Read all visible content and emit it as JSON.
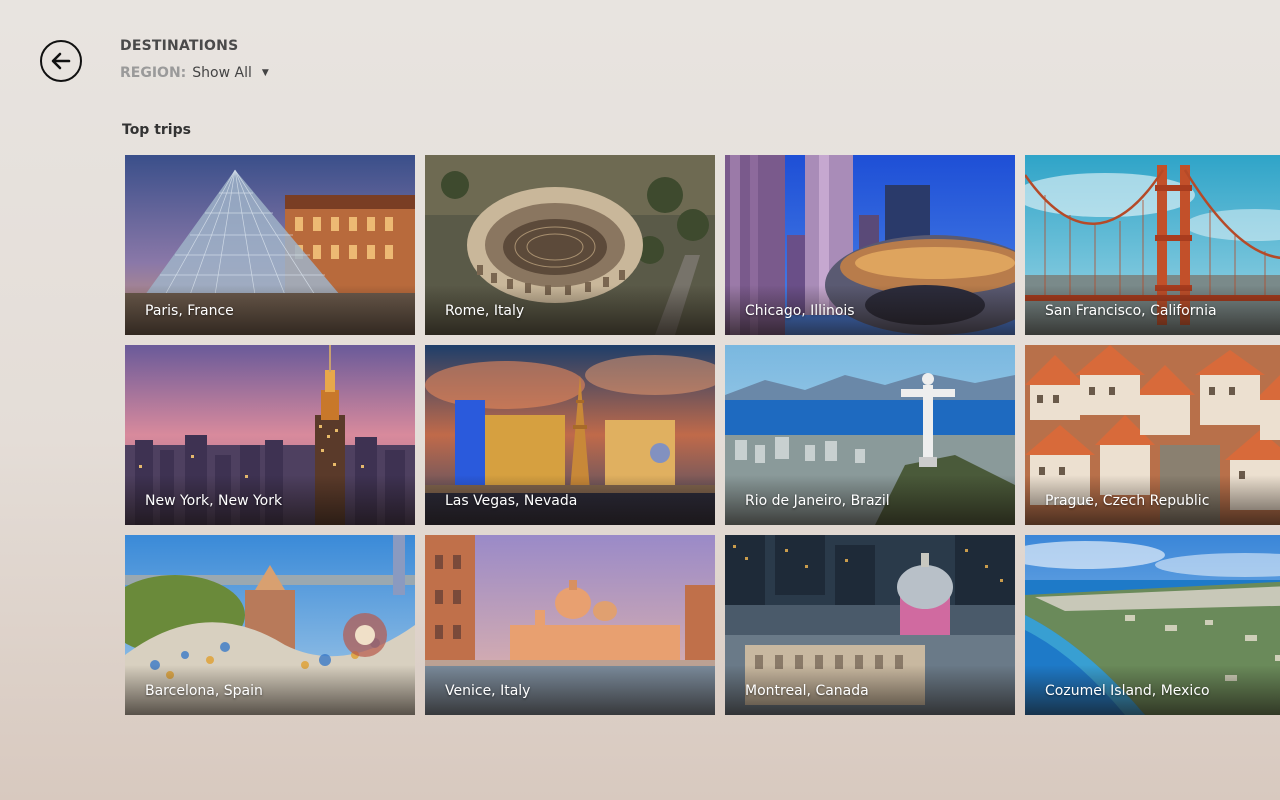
{
  "header": {
    "title": "DESTINATIONS",
    "region_label": "REGION:",
    "region_value": "Show All"
  },
  "section": {
    "title": "Top trips"
  },
  "destinations": [
    {
      "label": "Paris, France",
      "scene": "pyramid"
    },
    {
      "label": "Rome, Italy",
      "scene": "colosseum"
    },
    {
      "label": "Chicago, Illinois",
      "scene": "skyline"
    },
    {
      "label": "San Francisco, California",
      "scene": "bridge"
    },
    {
      "label": "New York, New York",
      "scene": "dusk-city"
    },
    {
      "label": "Las Vegas, Nevada",
      "scene": "vegas"
    },
    {
      "label": "Rio de Janeiro, Brazil",
      "scene": "rio"
    },
    {
      "label": "Prague, Czech Republic",
      "scene": "rooftops"
    },
    {
      "label": "Barcelona, Spain",
      "scene": "park"
    },
    {
      "label": "Venice, Italy",
      "scene": "canal"
    },
    {
      "label": "Montreal, Canada",
      "scene": "dome"
    },
    {
      "label": "Cozumel Island, Mexico",
      "scene": "coast"
    }
  ]
}
